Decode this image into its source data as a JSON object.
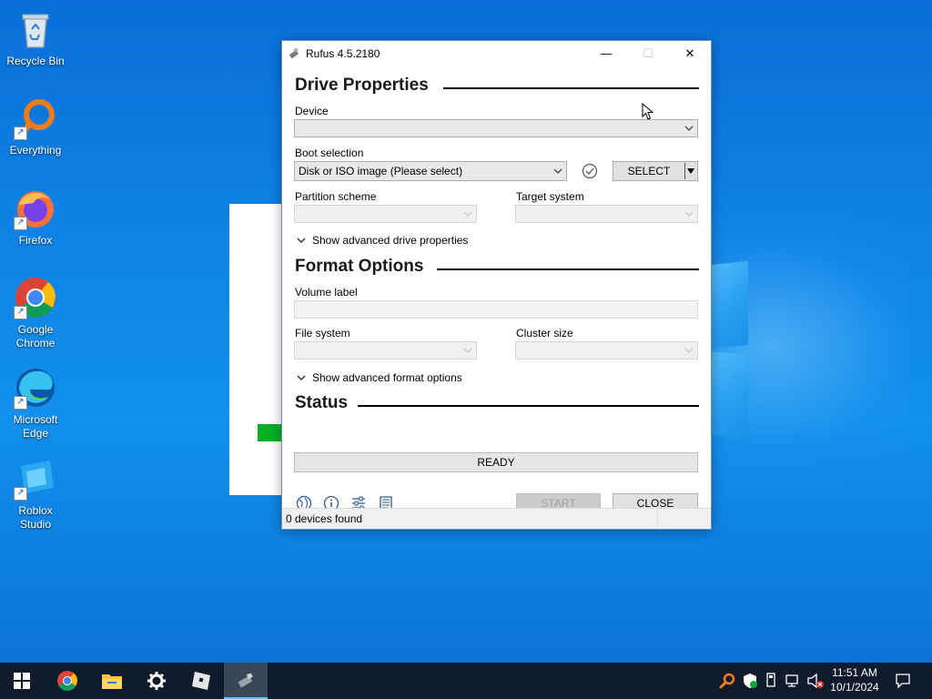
{
  "desktop": {
    "icons": [
      {
        "label": "Recycle Bin"
      },
      {
        "label": "Everything"
      },
      {
        "label": "Firefox"
      },
      {
        "label": "Google Chrome"
      },
      {
        "label": "Microsoft Edge"
      },
      {
        "label": "Roblox Studio"
      }
    ]
  },
  "window": {
    "title": "Rufus 4.5.2180",
    "minimize": "—",
    "maximize": "☐",
    "close": "✕"
  },
  "drive_properties": {
    "heading": "Drive Properties",
    "device_label": "Device",
    "device_value": "",
    "boot_selection_label": "Boot selection",
    "boot_selection_value": "Disk or ISO image (Please select)",
    "select_button": "SELECT",
    "partition_scheme_label": "Partition scheme",
    "partition_scheme_value": "",
    "target_system_label": "Target system",
    "target_system_value": "",
    "advanced_toggle": "Show advanced drive properties"
  },
  "format_options": {
    "heading": "Format Options",
    "volume_label_label": "Volume label",
    "volume_label_value": "",
    "file_system_label": "File system",
    "file_system_value": "",
    "cluster_size_label": "Cluster size",
    "cluster_size_value": "",
    "advanced_toggle": "Show advanced format options"
  },
  "status": {
    "heading": "Status",
    "progress_text": "READY",
    "start_button": "START",
    "close_button": "CLOSE",
    "footer_text": "0 devices found"
  },
  "taskbar": {
    "time": "11:51 AM",
    "date": "10/1/2024"
  },
  "colors": {
    "accent": "#0a6fd8",
    "progress_green": "#06b025",
    "taskbar": "#101c2b"
  }
}
